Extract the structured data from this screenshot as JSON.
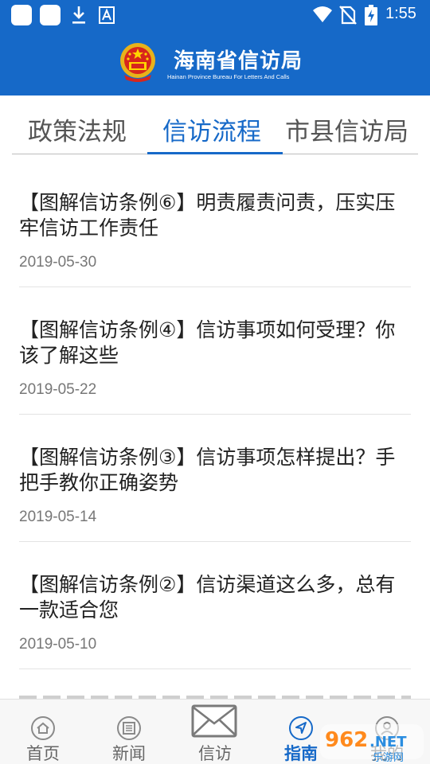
{
  "status_bar": {
    "time": "1:55",
    "icons": [
      "app-notification-icon",
      "app-notification-icon",
      "download-icon",
      "font-icon",
      "wifi-icon",
      "no-sim-icon",
      "battery-charging-icon"
    ]
  },
  "header": {
    "title": "海南省信访局",
    "subtitle": "Hainan Province Bureau For Letters And Calls",
    "emblem_icon": "national-emblem-icon"
  },
  "tabs": [
    {
      "label": "政策法规",
      "active": false
    },
    {
      "label": "信访流程",
      "active": true
    },
    {
      "label": "市县信访局",
      "active": false
    }
  ],
  "articles": [
    {
      "title": "【图解信访条例⑥】明责履责问责，压实压牢信访工作责任",
      "date": "2019-05-30"
    },
    {
      "title": "【图解信访条例④】信访事项如何受理？你该了解这些",
      "date": "2019-05-22"
    },
    {
      "title": "【图解信访条例③】信访事项怎样提出？手把手教你正确姿势",
      "date": "2019-05-14"
    },
    {
      "title": "【图解信访条例②】信访渠道这么多，总有一款适合您",
      "date": "2019-05-10"
    }
  ],
  "bottom_nav": [
    {
      "label": "首页",
      "icon": "home-icon",
      "active": false
    },
    {
      "label": "新闻",
      "icon": "news-icon",
      "active": false
    },
    {
      "label": "信访",
      "icon": "envelope-icon",
      "active": false
    },
    {
      "label": "指南",
      "icon": "compass-icon",
      "active": true
    },
    {
      "label": "我的",
      "icon": "profile-icon",
      "active": false
    }
  ],
  "watermark": {
    "text": "962.NET",
    "subtext": "乐游网"
  },
  "colors": {
    "primary": "#1669c8",
    "text": "#222222",
    "muted": "#777777"
  }
}
